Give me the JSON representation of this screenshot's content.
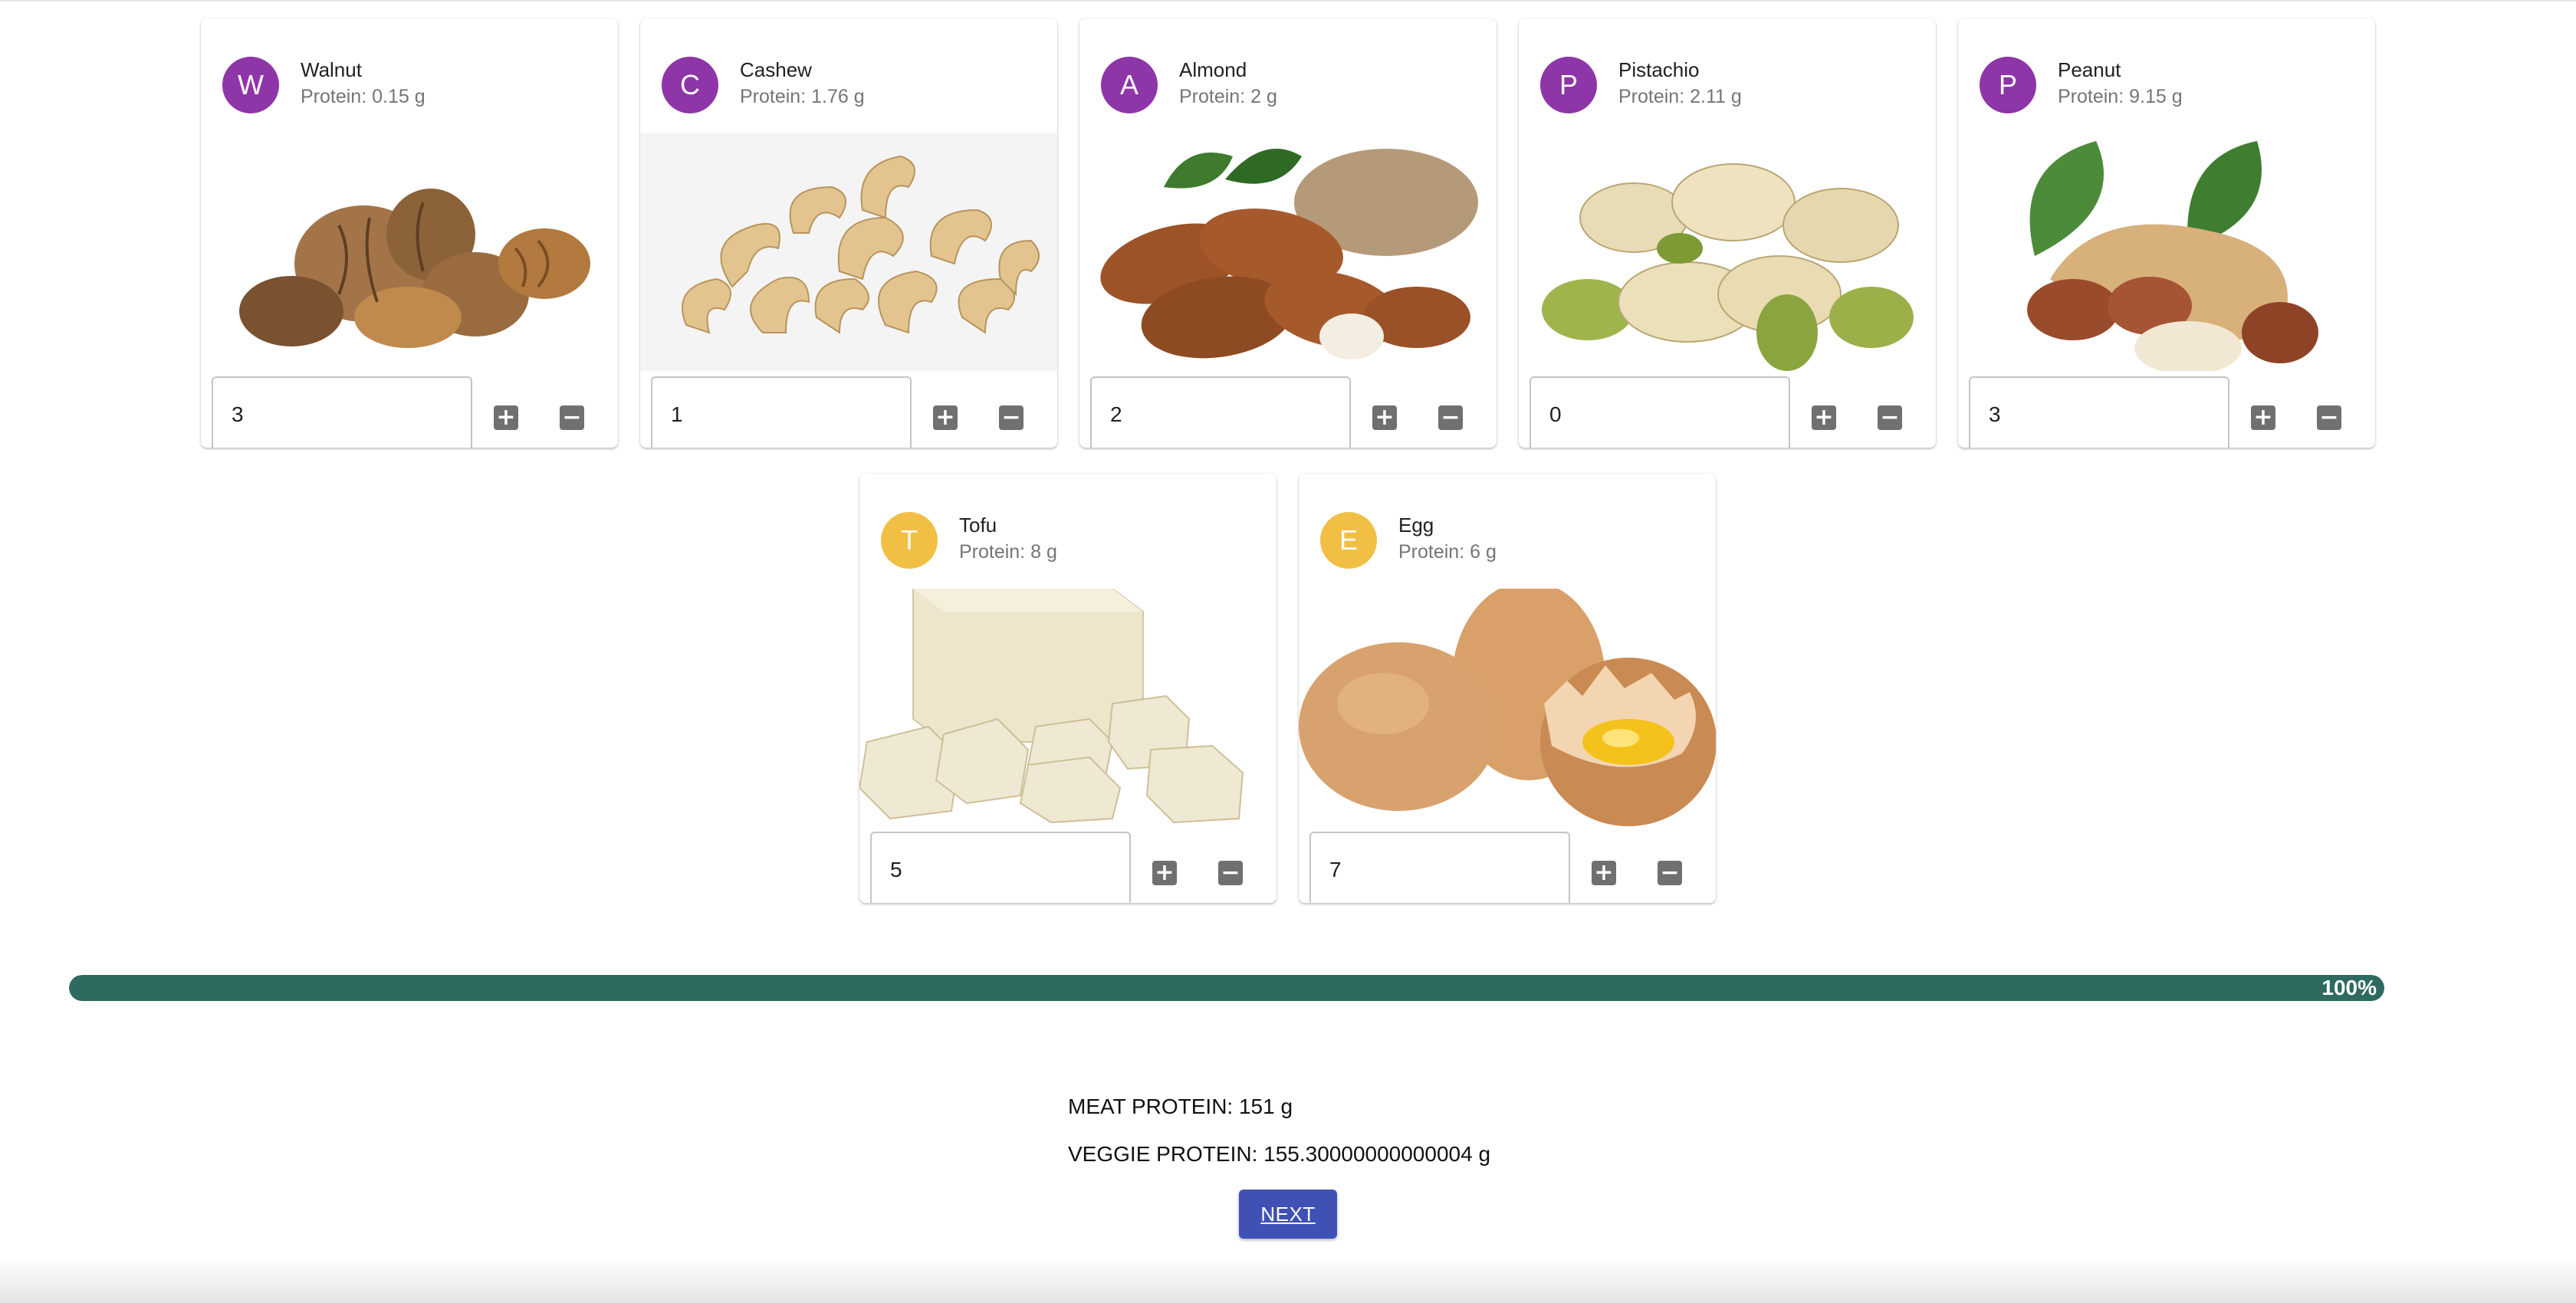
{
  "foods": [
    {
      "name": "Walnut",
      "avatar_letter": "W",
      "avatar_color": "#8e35a8",
      "protein": "Protein: 0.15 g",
      "quantity": "3",
      "image_icon": "walnut-image"
    },
    {
      "name": "Cashew",
      "avatar_letter": "C",
      "avatar_color": "#8e35a8",
      "protein": "Protein: 1.76 g",
      "quantity": "1",
      "image_icon": "cashew-image"
    },
    {
      "name": "Almond",
      "avatar_letter": "A",
      "avatar_color": "#8e35a8",
      "protein": "Protein: 2 g",
      "quantity": "2",
      "image_icon": "almond-image"
    },
    {
      "name": "Pistachio",
      "avatar_letter": "P",
      "avatar_color": "#8e35a8",
      "protein": "Protein: 2.11 g",
      "quantity": "0",
      "image_icon": "pistachio-image"
    },
    {
      "name": "Peanut",
      "avatar_letter": "P",
      "avatar_color": "#8e35a8",
      "protein": "Protein: 9.15 g",
      "quantity": "3",
      "image_icon": "peanut-image"
    },
    {
      "name": "Tofu",
      "avatar_letter": "T",
      "avatar_color": "#f1bf44",
      "protein": "Protein: 8 g",
      "quantity": "5",
      "image_icon": "tofu-image"
    },
    {
      "name": "Egg",
      "avatar_letter": "E",
      "avatar_color": "#f1bf44",
      "protein": "Protein: 6 g",
      "quantity": "7",
      "image_icon": "egg-image"
    }
  ],
  "controls": {
    "plus_symbol": "+",
    "minus_symbol": "−"
  },
  "progress": {
    "value_percent": 100,
    "label": "100%",
    "color": "#2e6a5f"
  },
  "summary": {
    "meat_protein": "MEAT PROTEIN: 151 g",
    "veggie_protein": "VEGGIE PROTEIN: 155.30000000000004 g"
  },
  "next_button": {
    "label": "NEXT",
    "color": "#3f51b5"
  }
}
